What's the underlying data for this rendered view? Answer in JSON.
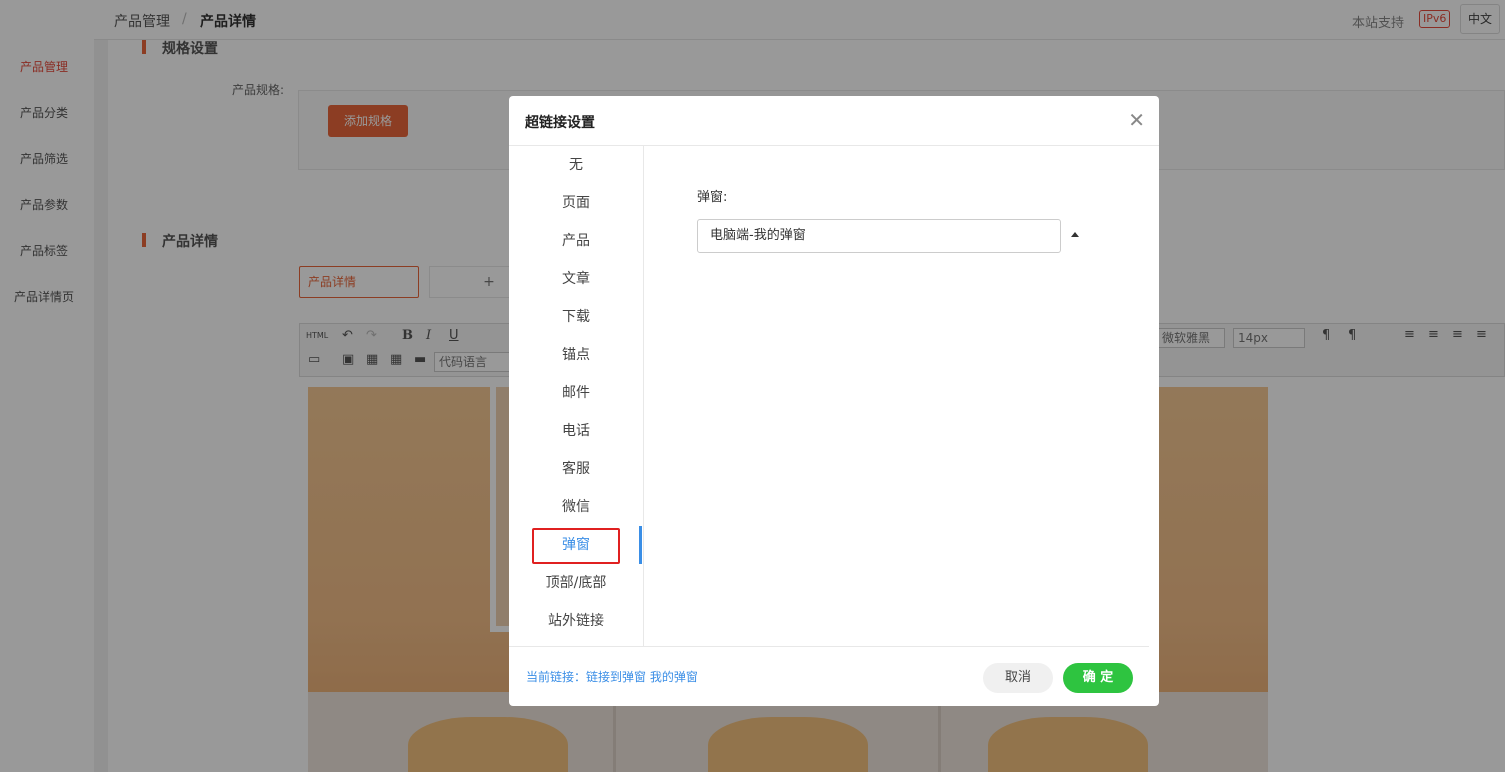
{
  "sidebar": {
    "items": [
      {
        "label": "产品管理",
        "active": true
      },
      {
        "label": "产品分类"
      },
      {
        "label": "产品筛选"
      },
      {
        "label": "产品参数"
      },
      {
        "label": "产品标签"
      },
      {
        "label": "产品详情页"
      }
    ]
  },
  "header": {
    "breadcrumb": [
      "产品管理",
      "/",
      "产品详情"
    ],
    "ipv6_text": "本站支持",
    "ipv6_badge": "IPv6",
    "language": "中文"
  },
  "main": {
    "spec_section_title": "规格设置",
    "spec_label": "产品规格:",
    "add_spec_button": "添加规格",
    "detail_section_title": "产品详情",
    "detail_tab": "产品详情",
    "add_tab": "+",
    "toolbar": {
      "html_label": "HTML",
      "bold": "B",
      "italic": "I",
      "underline": "U",
      "font_family": "微软雅黑",
      "font_size": "14px",
      "code_language": "代码语言"
    }
  },
  "modal": {
    "title": "超链接设置",
    "close_icon": "close-icon",
    "menu": [
      "无",
      "页面",
      "产品",
      "文章",
      "下载",
      "锚点",
      "邮件",
      "电话",
      "客服",
      "微信",
      "弹窗",
      "顶部/底部",
      "站外链接"
    ],
    "selected_menu": "弹窗",
    "field_label": "弹窗:",
    "select_value": "电脑端-我的弹窗",
    "current_link": "当前链接：链接到弹窗 我的弹窗",
    "cancel": "取消",
    "confirm": "确 定",
    "colors": {
      "accent": "#3a8ee6",
      "confirm": "#2ec440",
      "highlight": "#e02020"
    }
  }
}
